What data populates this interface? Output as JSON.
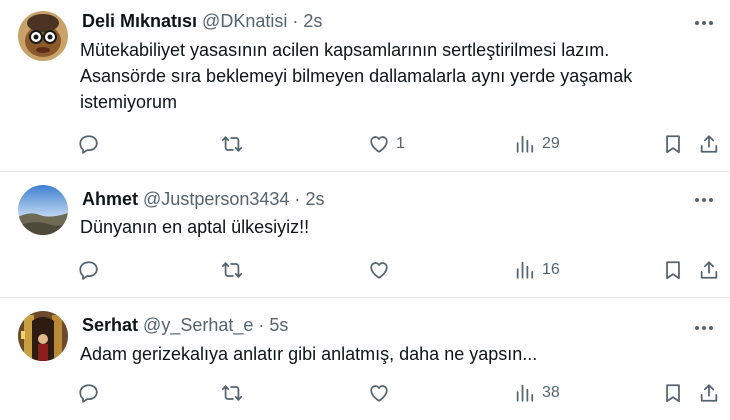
{
  "tweets": [
    {
      "name": "Deli Mıknatısı",
      "handle": "@DKnatisi",
      "separator": "·",
      "time": "2s",
      "text": "Mütekabiliyet yasasının acilen kapsamlarının sertleştirilmesi lazım.\nAsansörde sıra beklemeyi bilmeyen dallamalarla aynı yerde yaşamak istemiyorum",
      "likes": "1",
      "views": "29"
    },
    {
      "name": "Ahmet",
      "handle": "@Justperson3434",
      "separator": "·",
      "time": "2s",
      "text": "Dünyanın en aptal ülkesiyiz!!",
      "likes": "",
      "views": "16"
    },
    {
      "name": "Serhat",
      "handle": "@y_Serhat_e",
      "separator": "·",
      "time": "5s",
      "text": "Adam gerizekalıya anlatır gibi anlatmış, daha ne yapsın...",
      "likes": "",
      "views": "38"
    }
  ],
  "icons": {
    "reply": "reply-icon",
    "retweet": "retweet-icon",
    "like": "heart-icon",
    "views": "views-icon",
    "bookmark": "bookmark-icon",
    "share": "share-icon",
    "more": "more-icon"
  },
  "colors": {
    "text": "#0f1419",
    "secondary": "#536471",
    "divider": "#e4e8eb"
  }
}
